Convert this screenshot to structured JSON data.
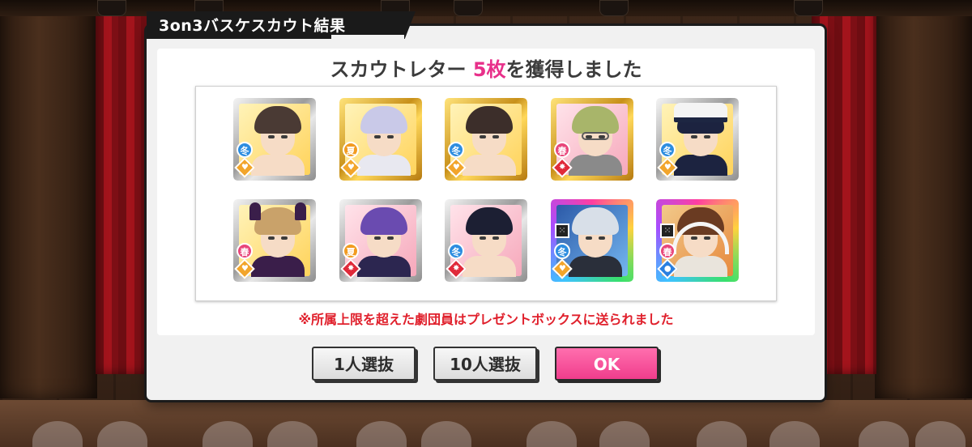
{
  "dialog": {
    "title": "3on3バスケスカウト結果",
    "headline_prefix": "スカウトレター ",
    "headline_count": "5枚",
    "headline_suffix": "を獲得しました",
    "notice": "※所属上限を超えた劇団員はプレゼントボックスに送られました"
  },
  "buttons": {
    "select_one": "1人選抜",
    "select_ten": "10人選抜",
    "ok": "OK"
  },
  "cards": [
    {
      "season": "冬",
      "season_class": "winter",
      "rarity": "silver",
      "bg": "yellow",
      "hair": "#4a3a34",
      "outfit": "#f6dcc6",
      "type": "cool"
    },
    {
      "season": "夏",
      "season_class": "summer",
      "rarity": "gold",
      "bg": "yellow",
      "hair": "#c9c9e8",
      "outfit": "#e8e8f0",
      "type": "cool"
    },
    {
      "season": "冬",
      "season_class": "winter",
      "rarity": "gold",
      "bg": "yellow",
      "hair": "#3c2e2a",
      "outfit": "#f6dcc6",
      "type": "cool"
    },
    {
      "season": "春",
      "season_class": "spring",
      "rarity": "gold",
      "bg": "pink",
      "hair": "#a8b56a",
      "outfit": "#8a8a8a",
      "type": "red"
    },
    {
      "season": "冬",
      "season_class": "winter",
      "rarity": "silver",
      "bg": "yellow",
      "hair": "#1c2340",
      "outfit": "#1c2340",
      "type": "cool"
    },
    {
      "season": "春",
      "season_class": "spring",
      "rarity": "silver",
      "bg": "yellow",
      "hair": "#c9a26a",
      "outfit": "#3a1e4a",
      "type": "cool"
    },
    {
      "season": "夏",
      "season_class": "summer",
      "rarity": "silver",
      "bg": "pink",
      "hair": "#6a4bb0",
      "outfit": "#2c2650",
      "type": "red"
    },
    {
      "season": "冬",
      "season_class": "winter",
      "rarity": "silver",
      "bg": "pink",
      "hair": "#1c1f33",
      "outfit": "#f6dcc6",
      "type": "red"
    },
    {
      "season": "冬",
      "season_class": "winter",
      "rarity": "rainbow",
      "bg": "blue",
      "hair": "#d8dfe8",
      "outfit": "#2a2f3a",
      "type": "cool"
    },
    {
      "season": "春",
      "season_class": "spring",
      "rarity": "rainbow",
      "bg": "warm",
      "hair": "#6a3b22",
      "outfit": "#e9e4dc",
      "type": "water"
    }
  ],
  "colors": {
    "accent_pink": "#e8308a",
    "notice_red": "#e0202c",
    "ok_button": "#f03d8c"
  }
}
